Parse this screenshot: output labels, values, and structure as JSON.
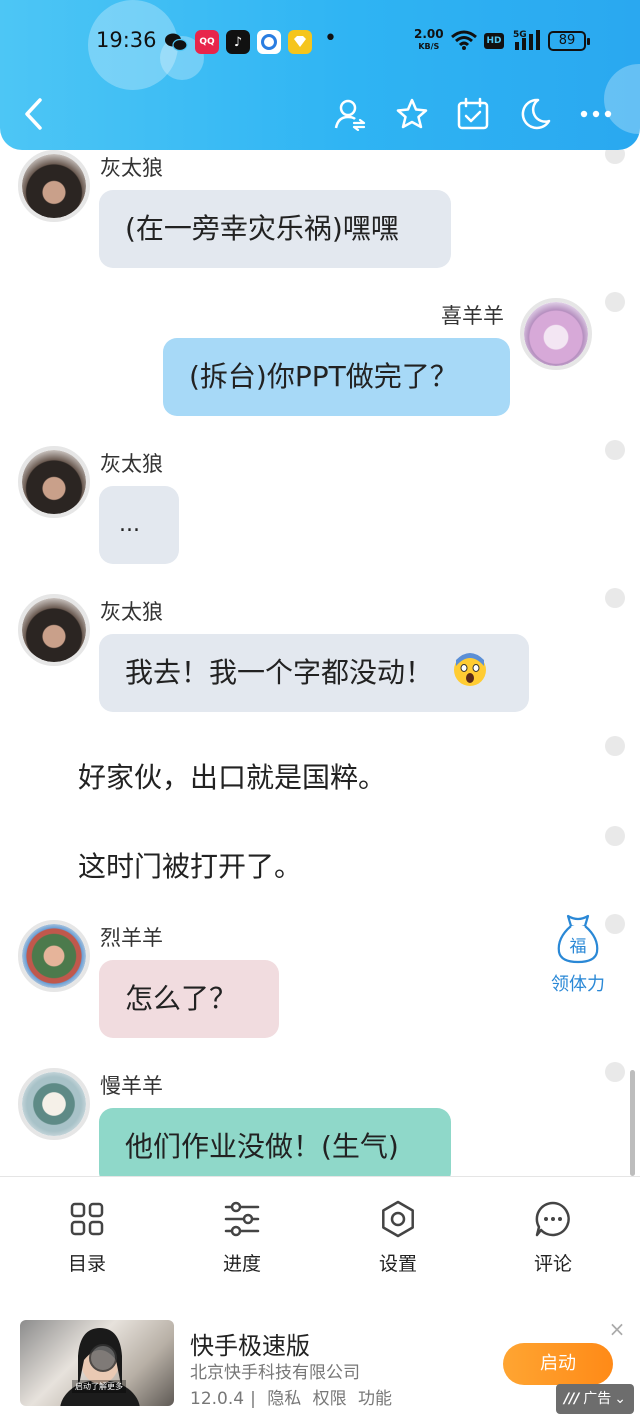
{
  "status_bar": {
    "time": "19:36",
    "net_speed_value": "2.00",
    "net_speed_unit": "KB/S",
    "hd": "HD",
    "network": "5G",
    "battery": "89"
  },
  "nav": {
    "icons": [
      "back-icon",
      "switch-user-icon",
      "star-icon",
      "calendar-icon",
      "moon-icon",
      "more-icon"
    ]
  },
  "chat": {
    "messages": [
      {
        "speaker": "灰太狼",
        "text": "(在一旁幸灾乐祸)嘿嘿"
      },
      {
        "speaker": "喜羊羊",
        "text": "(拆台)你PPT做完了？"
      },
      {
        "speaker": "灰太狼",
        "text": "..."
      },
      {
        "speaker": "灰太狼",
        "text": "我去！我一个字都没动！",
        "emoji": "😱"
      },
      {
        "narration": "好家伙，出口就是国粹。"
      },
      {
        "narration": "这时门被打开了。"
      },
      {
        "speaker": "烈羊羊",
        "text": "怎么了？"
      },
      {
        "speaker": "慢羊羊",
        "text": "他们作业没做！(生气)"
      }
    ]
  },
  "fu_widget": {
    "glyph": "福",
    "label": "领体力"
  },
  "toolbar": {
    "items": [
      {
        "label": "目录",
        "icon": "catalog-icon"
      },
      {
        "label": "进度",
        "icon": "progress-icon"
      },
      {
        "label": "设置",
        "icon": "settings-icon"
      },
      {
        "label": "评论",
        "icon": "comment-icon"
      }
    ]
  },
  "ad": {
    "thumb_caption": "启动了解更多",
    "title": "快手极速版",
    "company": "北京快手科技有限公司",
    "version": "12.0.4",
    "links": [
      "隐私",
      "权限",
      "功能"
    ],
    "button": "启动",
    "badge": "广告",
    "close": "×"
  },
  "colors": {
    "header": "#2fb4f3",
    "bubble_gray": "#e3e8ef",
    "bubble_blue": "#a7d9f7",
    "bubble_pink": "#f1dcdf",
    "bubble_teal": "#8fd8c9",
    "ad_button": "#ff9a25"
  }
}
